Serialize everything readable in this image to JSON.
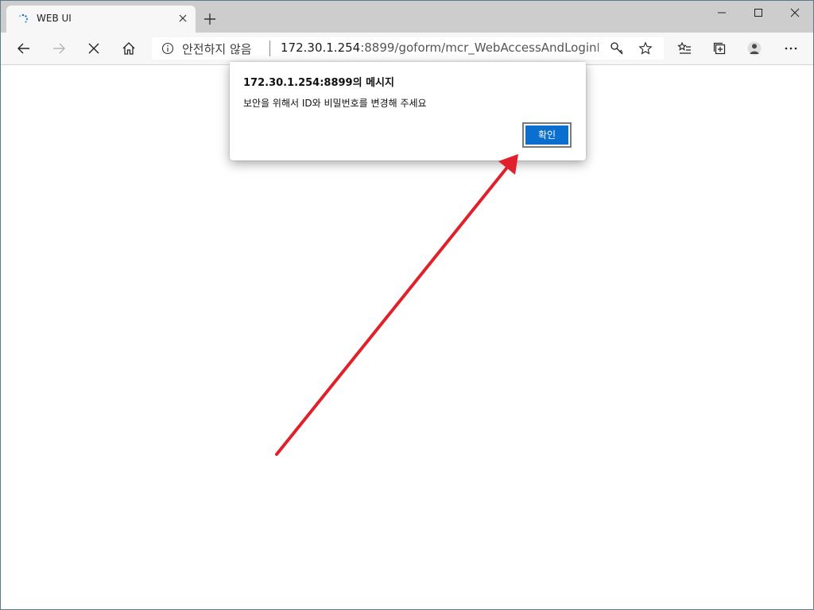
{
  "browser": {
    "tab": {
      "title": "WEB UI",
      "favicon": "loading-spinner-icon"
    },
    "address_bar": {
      "security_label": "안전하지 않음",
      "url_host": "172.30.1.254",
      "url_rest": ":8899/goform/mcr_WebAccessAndLoginPr..."
    },
    "toolbar_icons": [
      "back-icon",
      "forward-icon",
      "stop-icon",
      "home-icon",
      "info-icon",
      "key-icon",
      "star-icon",
      "favorites-icon",
      "collections-icon",
      "profile-icon",
      "more-icon"
    ],
    "accent_color": "#0a6fce"
  },
  "dialog": {
    "title": "172.30.1.254:8899의 메시지",
    "message": "보안을 위해서 ID와 비밀번호를 변경해 주세요",
    "ok_label": "확인"
  },
  "annotation": {
    "type": "red-arrow",
    "color": "#e0212b",
    "points_to": "ok-button"
  }
}
